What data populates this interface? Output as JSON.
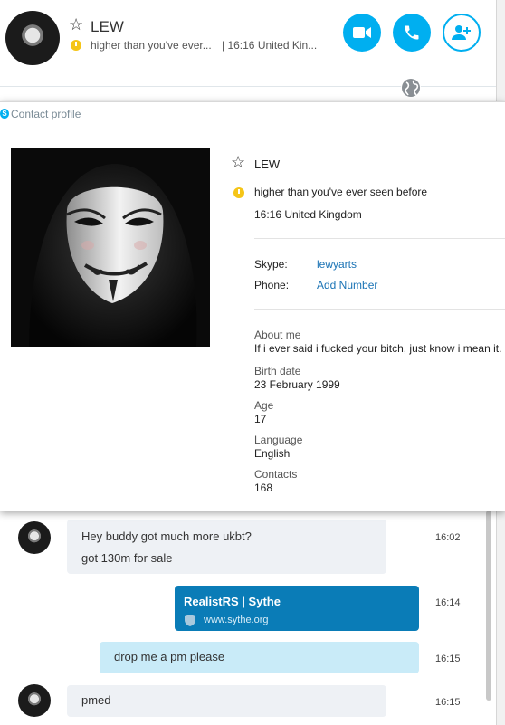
{
  "header": {
    "name": "LEW",
    "mood": "higher than you've ever...",
    "time_location": "| 16:16 United Kin...",
    "video_call_icon": "video-camera-icon",
    "call_icon": "phone-icon",
    "add_contact_icon": "add-person-icon"
  },
  "profile": {
    "panel_title": "Contact profile",
    "name": "LEW",
    "mood": "higher than you've ever seen before",
    "local_time": "16:16 United Kingdom",
    "skype_label": "Skype:",
    "skype_value": "lewyarts",
    "phone_label": "Phone:",
    "phone_value": "Add Number",
    "about_label": "About me",
    "about_value": "If i ever said i fucked your bitch, just know i mean it.",
    "birth_label": "Birth date",
    "birth_value": "23 February 1999",
    "age_label": "Age",
    "age_value": "17",
    "language_label": "Language",
    "language_value": "English",
    "contacts_label": "Contacts",
    "contacts_value": "168"
  },
  "messages": [
    {
      "from": "contact",
      "lines": [
        "Hey buddy got much more ukbt?",
        "got 130m for sale"
      ],
      "time": "16:02"
    },
    {
      "from": "me",
      "link_title": "RealistRS | Sythe",
      "link_url": "www.sythe.org",
      "time": "16:14"
    },
    {
      "from": "me",
      "text": "drop me a pm please",
      "time": "16:15"
    },
    {
      "from": "contact",
      "text": "pmed",
      "time": "16:15"
    }
  ],
  "colors": {
    "accent": "#00aff0",
    "link_card": "#0a7cb7",
    "my_bubble": "#c9ebf8",
    "their_bubble": "#eef1f5",
    "mood": "#f5c518"
  }
}
